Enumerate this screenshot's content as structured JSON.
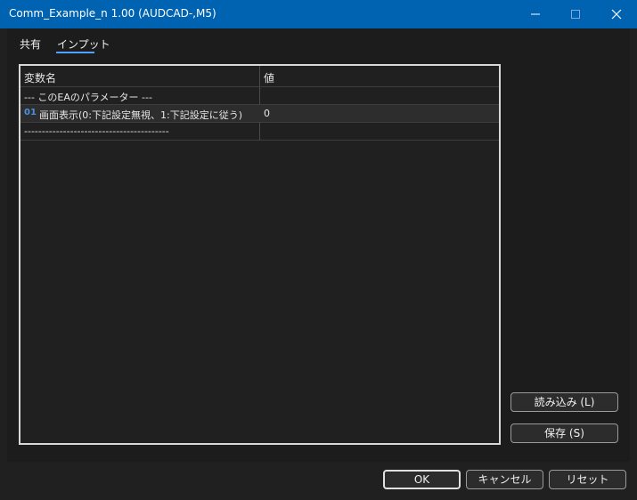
{
  "window": {
    "title": "Comm_Example_n 1.00 (AUDCAD-,M5)"
  },
  "tabs": [
    {
      "label": "共有"
    },
    {
      "label": "インプット"
    }
  ],
  "table": {
    "headers": {
      "name": "変数名",
      "value": "値"
    },
    "rows": [
      {
        "name": "--- このEAのパラメーター ---",
        "value": ""
      },
      {
        "icon": "01",
        "name": "画面表示(0:下記設定無視、1:下記設定に従う)",
        "value": "0"
      },
      {
        "name": "-----------------------------------------",
        "value": ""
      }
    ]
  },
  "buttons": {
    "load": "読み込み (L)",
    "save": "保存 (S)",
    "ok": "OK",
    "cancel": "キャンセル",
    "reset": "リセット"
  },
  "colors": {
    "titlebar": "#0063b1",
    "accent": "#4fa3ff",
    "background": "#202020"
  }
}
